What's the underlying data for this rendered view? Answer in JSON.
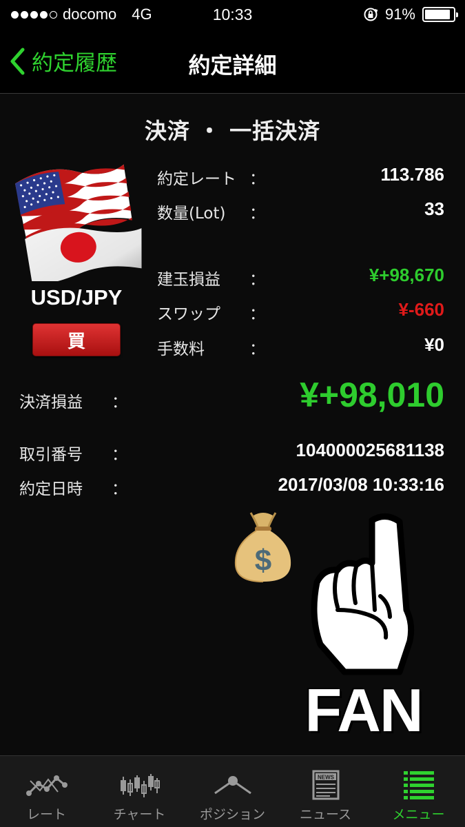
{
  "status_bar": {
    "carrier": "docomo",
    "network": "4G",
    "time": "10:33",
    "battery": "91%",
    "battery_level": 0.91
  },
  "nav": {
    "back_label": "約定履歴",
    "title": "約定詳細"
  },
  "trade": {
    "type_title": "決済 ・ 一括決済",
    "pair": "USD/JPY",
    "side": "買",
    "fields": [
      {
        "label": "約定レート",
        "colon": "：",
        "value": "113.786"
      },
      {
        "label": "数量(Lot)",
        "colon": "：",
        "value": "33"
      },
      {
        "label": "建玉損益",
        "colon": "：",
        "value": "¥+98,670"
      },
      {
        "label": "スワップ",
        "colon": "：",
        "value": "¥-660"
      },
      {
        "label": "手数料",
        "colon": "：",
        "value": "¥0"
      }
    ],
    "settlement_label": "決済損益",
    "settlement_colon": "：",
    "settlement_value": "¥+98,010",
    "trade_no_label": "取引番号",
    "trade_no_colon": "：",
    "trade_no": "104000025681138",
    "datetime_label": "約定日時",
    "datetime_colon": "：",
    "datetime": "2017/03/08 10:33:16"
  },
  "overlay": {
    "sticker_text": "FAN"
  },
  "tabs": [
    {
      "label": "レート",
      "icon": "rate-chart-icon"
    },
    {
      "label": "チャート",
      "icon": "candlestick-icon"
    },
    {
      "label": "ポジション",
      "icon": "position-icon"
    },
    {
      "label": "ニュース",
      "icon": "news-icon"
    },
    {
      "label": "メニュー",
      "icon": "menu-list-icon"
    }
  ],
  "colors": {
    "accent_green": "#2fd22f",
    "profit_green": "#2ecc2e",
    "loss_red": "#e01a1a",
    "buy_red": "#c81d1d"
  }
}
